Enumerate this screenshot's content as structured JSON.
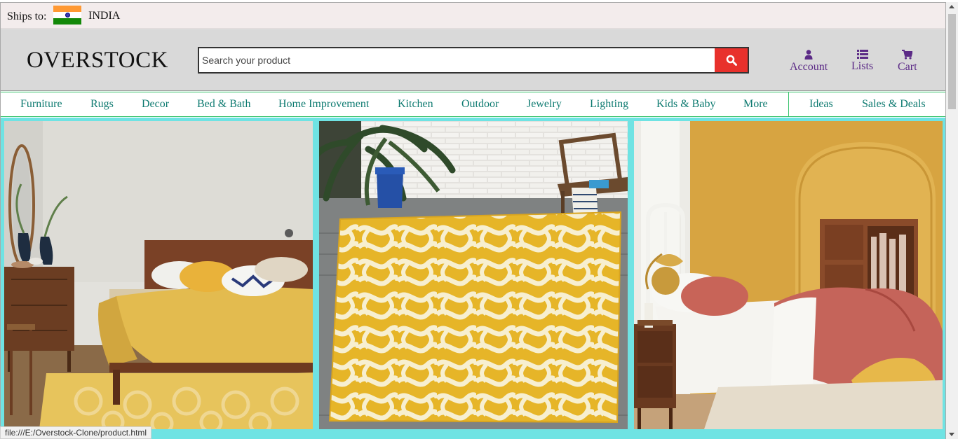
{
  "ships": {
    "label": "Ships to:",
    "country": "INDIA",
    "flag_icon": "india-flag-icon"
  },
  "header": {
    "logo": "OVERSTOCK",
    "search_placeholder": "Search your product",
    "search_icon": "search-icon",
    "links": [
      {
        "label": "Account",
        "icon": "user-icon"
      },
      {
        "label": "Lists",
        "icon": "list-icon"
      },
      {
        "label": "Cart",
        "icon": "cart-icon"
      }
    ]
  },
  "nav": {
    "items": [
      "Furniture",
      "Rugs",
      "Decor",
      "Bed & Bath",
      "Home Improvement",
      "Kitchen",
      "Outdoor",
      "Jewelry",
      "Lighting",
      "Kids & Baby",
      "More",
      "Ideas",
      "Sales & Deals"
    ]
  },
  "banner": {
    "images": [
      "bedroom-wood-bed-yellow-quilt-image",
      "yellow-trellis-rug-patio-image",
      "bedroom-yellow-wall-coral-bedding-image"
    ]
  },
  "status_url": "file:///E:/Overstock-Clone/product.html",
  "colors": {
    "ships_bar_bg": "#f3ecec",
    "header_bg": "#d9d9d9",
    "search_button": "#e8312c",
    "header_link": "#5b2a86",
    "nav_text": "#0d7a70",
    "nav_border": "#35c26a",
    "banner_bg": "#6fe3e3"
  }
}
